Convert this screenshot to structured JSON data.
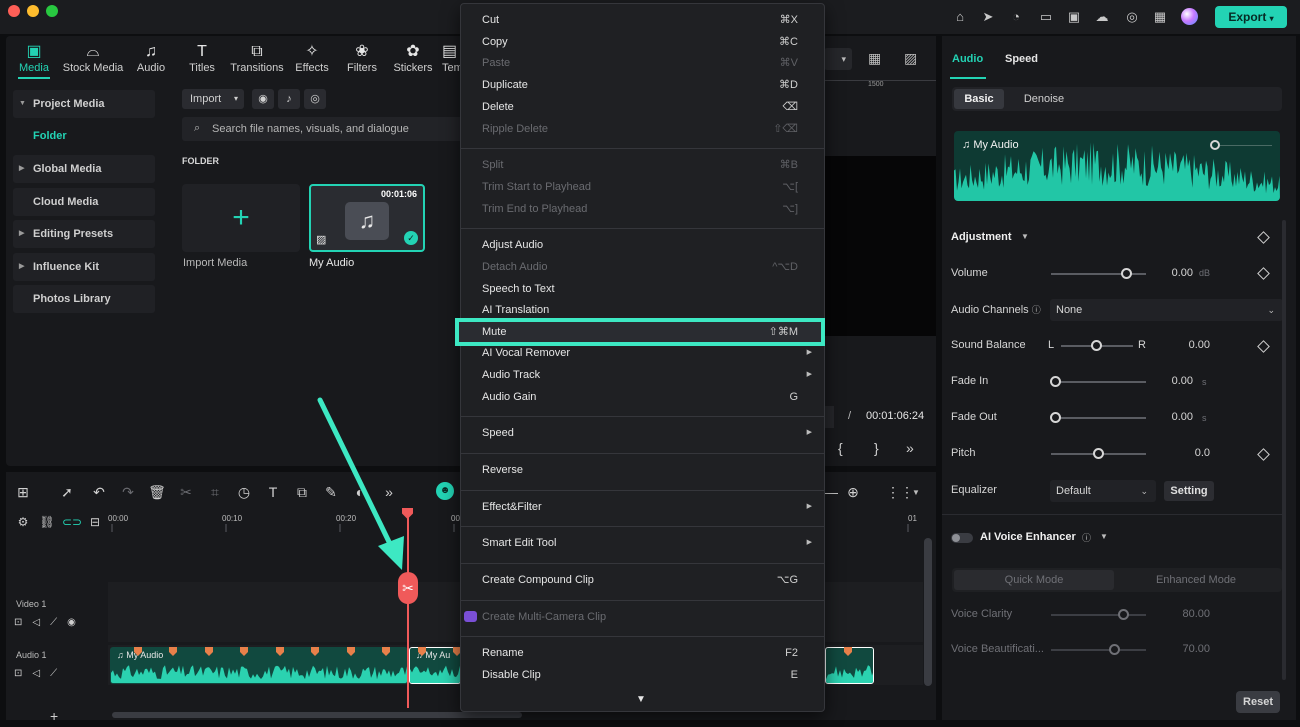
{
  "app": {
    "export_label": "Export",
    "accent": "#23d3b4"
  },
  "toolbar_tabs": [
    {
      "label": "Media",
      "icon": "media-icon"
    },
    {
      "label": "Stock Media",
      "icon": "stock-media-icon"
    },
    {
      "label": "Audio",
      "icon": "music-note-icon"
    },
    {
      "label": "Titles",
      "icon": "titles-icon"
    },
    {
      "label": "Transitions",
      "icon": "transitions-icon"
    },
    {
      "label": "Effects",
      "icon": "effects-icon"
    },
    {
      "label": "Filters",
      "icon": "filters-icon"
    },
    {
      "label": "Stickers",
      "icon": "stickers-icon"
    },
    {
      "label": "Tem",
      "icon": "templates-icon"
    }
  ],
  "sidebar": {
    "items": [
      {
        "label": "Project Media",
        "expandable": true
      },
      {
        "label": "Global Media",
        "expandable": true
      },
      {
        "label": "Cloud Media",
        "expandable": false
      },
      {
        "label": "Editing Presets",
        "expandable": true
      },
      {
        "label": "Influence Kit",
        "expandable": true
      },
      {
        "label": "Photos Library",
        "expandable": false
      }
    ],
    "folder_label": "Folder"
  },
  "media": {
    "import_label": "Import",
    "search_placeholder": "Search file names, visuals, and dialogue",
    "folder_heading": "FOLDER",
    "import_media_label": "Import Media",
    "clip_label": "My Audio",
    "clip_duration": "00:01:06"
  },
  "player": {
    "ruler_mark": "1500",
    "separator": "/",
    "total_time": "00:01:06:24"
  },
  "right_panel": {
    "tabs": [
      "Audio",
      "Speed"
    ],
    "subtabs": [
      "Basic",
      "Denoise"
    ],
    "waveform_title": "My Audio",
    "adjustment_label": "Adjustment",
    "volume": {
      "label": "Volume",
      "value": "0.00",
      "unit": "dB",
      "level": 0.74
    },
    "audio_channels": {
      "label": "Audio Channels",
      "value": "None"
    },
    "sound_balance": {
      "label": "Sound Balance",
      "left": "L",
      "right": "R",
      "value": "0.00",
      "level": 0.5
    },
    "fade_in": {
      "label": "Fade In",
      "value": "0.00",
      "unit": "s",
      "level": 0.0
    },
    "fade_out": {
      "label": "Fade Out",
      "value": "0.00",
      "unit": "s",
      "level": 0.0
    },
    "pitch": {
      "label": "Pitch",
      "value": "0.0",
      "level": 0.5
    },
    "equalizer": {
      "label": "Equalizer",
      "value": "Default",
      "setting_label": "Setting"
    },
    "ai_voice_enhancer": "AI Voice Enhancer",
    "modes": [
      "Quick Mode",
      "Enhanced Mode"
    ],
    "voice_clarity": {
      "label": "Voice Clarity",
      "value": "80.00",
      "level": 0.8
    },
    "voice_beautification": {
      "label": "Voice Beautificati...",
      "value": "70.00",
      "level": 0.7
    },
    "reset_label": "Reset"
  },
  "timeline": {
    "ticks": [
      "00:00",
      "00:10",
      "00:20",
      "00",
      "01"
    ],
    "tracks": [
      "Video 1",
      "Audio 1"
    ],
    "clip_label": "My Audio",
    "clip_label_short": "My Au"
  },
  "context_menu": {
    "groups": [
      [
        {
          "label": "Cut",
          "shortcut": "⌘X",
          "enabled": true
        },
        {
          "label": "Copy",
          "shortcut": "⌘C",
          "enabled": true
        },
        {
          "label": "Paste",
          "shortcut": "⌘V",
          "enabled": false
        },
        {
          "label": "Duplicate",
          "shortcut": "⌘D",
          "enabled": true
        },
        {
          "label": "Delete",
          "shortcut": "⌫",
          "enabled": true
        },
        {
          "label": "Ripple Delete",
          "shortcut": "⇧⌫",
          "enabled": false
        }
      ],
      [
        {
          "label": "Split",
          "shortcut": "⌘B",
          "enabled": false
        },
        {
          "label": "Trim Start to Playhead",
          "shortcut": "⌥[",
          "enabled": false
        },
        {
          "label": "Trim End to Playhead",
          "shortcut": "⌥]",
          "enabled": false
        }
      ],
      [
        {
          "label": "Adjust Audio",
          "shortcut": "",
          "enabled": true
        },
        {
          "label": "Detach Audio",
          "shortcut": "^⌥D",
          "enabled": false
        },
        {
          "label": "Speech to Text",
          "shortcut": "",
          "enabled": true
        },
        {
          "label": "AI Translation",
          "shortcut": "",
          "enabled": true
        },
        {
          "label": "Mute",
          "shortcut": "⇧⌘M",
          "enabled": true,
          "highlighted": true
        },
        {
          "label": "AI Vocal Remover",
          "shortcut": "",
          "enabled": true,
          "submenu": true
        },
        {
          "label": "Audio Track",
          "shortcut": "",
          "enabled": true,
          "submenu": true
        },
        {
          "label": "Audio Gain",
          "shortcut": "G",
          "enabled": true
        }
      ],
      [
        {
          "label": "Speed",
          "shortcut": "",
          "enabled": true,
          "submenu": true
        }
      ],
      [
        {
          "label": "Reverse",
          "shortcut": "",
          "enabled": true
        }
      ],
      [
        {
          "label": "Effect&Filter",
          "shortcut": "",
          "enabled": true,
          "submenu": true
        }
      ],
      [
        {
          "label": "Smart Edit Tool",
          "shortcut": "",
          "enabled": true,
          "submenu": true
        }
      ],
      [
        {
          "label": "Create Compound Clip",
          "shortcut": "⌥G",
          "enabled": true
        }
      ],
      [
        {
          "label": "Create Multi-Camera Clip",
          "shortcut": "",
          "enabled": false,
          "icon": "multicam-icon"
        }
      ],
      [
        {
          "label": "Rename",
          "shortcut": "F2",
          "enabled": true
        },
        {
          "label": "Disable Clip",
          "shortcut": "E",
          "enabled": true
        }
      ]
    ],
    "more_glyph": "▼"
  }
}
